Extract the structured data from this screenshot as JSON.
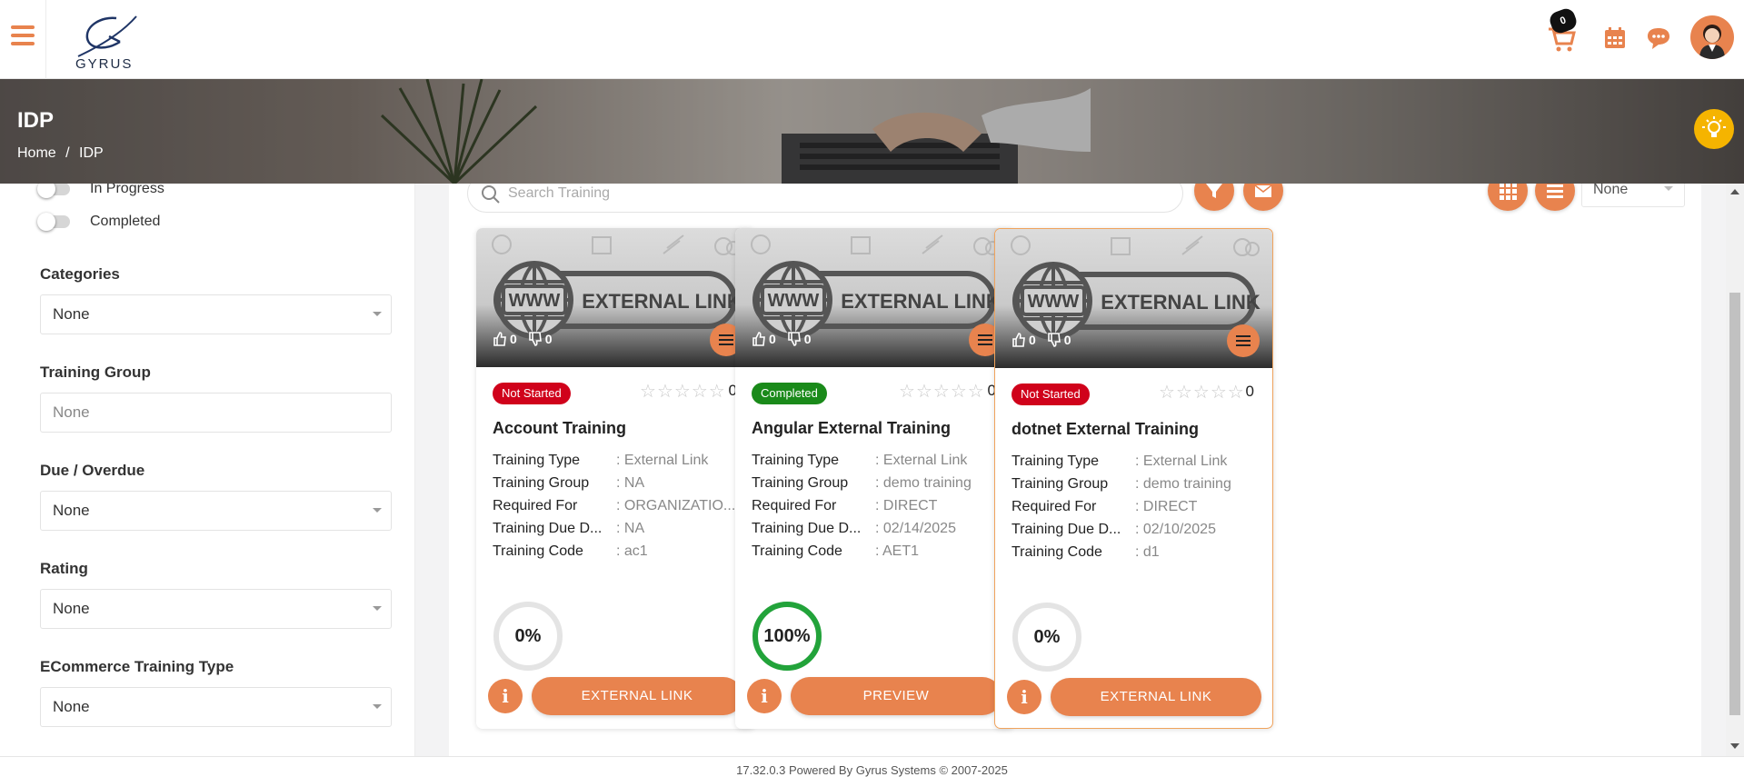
{
  "brand": {
    "logo_text": "GYRUS"
  },
  "header": {
    "cart_count": "0"
  },
  "banner": {
    "title": "IDP",
    "breadcrumb": [
      {
        "label": "Home"
      },
      {
        "label": "IDP"
      }
    ],
    "separator": "/"
  },
  "sidebar": {
    "toggles": [
      {
        "label": "In Progress"
      },
      {
        "label": "Completed"
      }
    ],
    "filters": [
      {
        "label": "Categories",
        "value": "None",
        "kind": "select"
      },
      {
        "label": "Training Group",
        "value": "None",
        "kind": "text"
      },
      {
        "label": "Due / Overdue",
        "value": "None",
        "kind": "select"
      },
      {
        "label": "Rating",
        "value": "None",
        "kind": "select"
      },
      {
        "label": "ECommerce Training Type",
        "value": "None",
        "kind": "select"
      }
    ]
  },
  "toolbar": {
    "search_placeholder": "Search Training",
    "sort_value": "None"
  },
  "detail_labels": {
    "type": "Training Type",
    "group": "Training Group",
    "required": "Required For",
    "due": "Training Due D...",
    "code": "Training Code"
  },
  "cards": [
    {
      "title": "Account Training",
      "status": "Not Started",
      "status_color": "#d0021b",
      "likes": "0",
      "dislikes": "0",
      "rating_count": "0",
      "type": ": External Link",
      "group": ": NA",
      "required": ": ORGANIZATIO...",
      "due": ": NA",
      "code": ":  ac1",
      "progress": "0%",
      "progress_value": 0,
      "action": "EXTERNAL LINK",
      "thumb_text": "EXTERNAL LINK",
      "thumb_www": "WWW"
    },
    {
      "title": "Angular External Training",
      "status": "Completed",
      "status_color": "#1a8a1a",
      "likes": "0",
      "dislikes": "0",
      "rating_count": "0",
      "type": ": External Link",
      "group": ": demo training",
      "required": ": DIRECT",
      "due": ": 02/14/2025",
      "code": ":  AET1",
      "progress": "100%",
      "progress_value": 100,
      "action": "PREVIEW",
      "thumb_text": "EXTERNAL LINK",
      "thumb_www": "WWW"
    },
    {
      "title": "dotnet External Training",
      "status": "Not Started",
      "status_color": "#d0021b",
      "likes": "0",
      "dislikes": "0",
      "rating_count": "0",
      "type": ": External Link",
      "group": ": demo training",
      "required": ": DIRECT",
      "due": ": 02/10/2025",
      "code": ":  d1",
      "progress": "0%",
      "progress_value": 0,
      "action": "EXTERNAL LINK",
      "thumb_text": "EXTERNAL LINK",
      "thumb_www": "WWW"
    }
  ],
  "colors": {
    "accent": "#e8834e",
    "progress_done": "#22a33a",
    "progress_track": "#e4e4e4"
  },
  "footer": {
    "text": "17.32.0.3 Powered By Gyrus Systems © 2007-2025"
  }
}
